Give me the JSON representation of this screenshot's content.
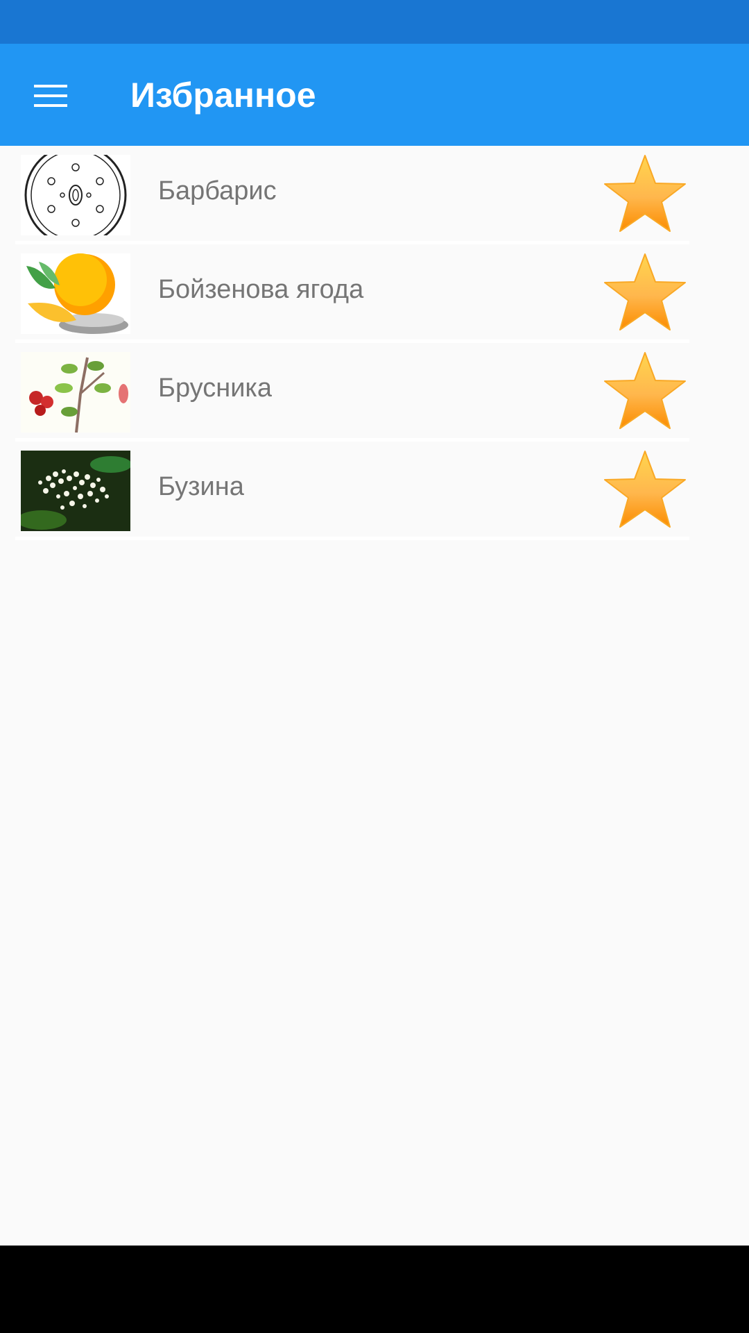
{
  "app_bar": {
    "title": "Избранное",
    "menu_icon": "hamburger-menu-icon",
    "background": "#2196f3",
    "status_bar_color": "#1976d2"
  },
  "favorites": [
    {
      "label": "Барбарис",
      "thumbnail_icon": "barberry-diagram-icon",
      "star_icon": "star-icon",
      "favorited": true
    },
    {
      "label": "Бойзенова ягода",
      "thumbnail_icon": "citrus-fruit-icon",
      "star_icon": "star-icon",
      "favorited": true
    },
    {
      "label": "Брусника",
      "thumbnail_icon": "lingonberry-plant-icon",
      "star_icon": "star-icon",
      "favorited": true
    },
    {
      "label": "Бузина",
      "thumbnail_icon": "elderberry-flowers-icon",
      "star_icon": "star-icon",
      "favorited": true
    }
  ],
  "colors": {
    "star_fill": "#ffa726",
    "item_text": "#757575"
  }
}
